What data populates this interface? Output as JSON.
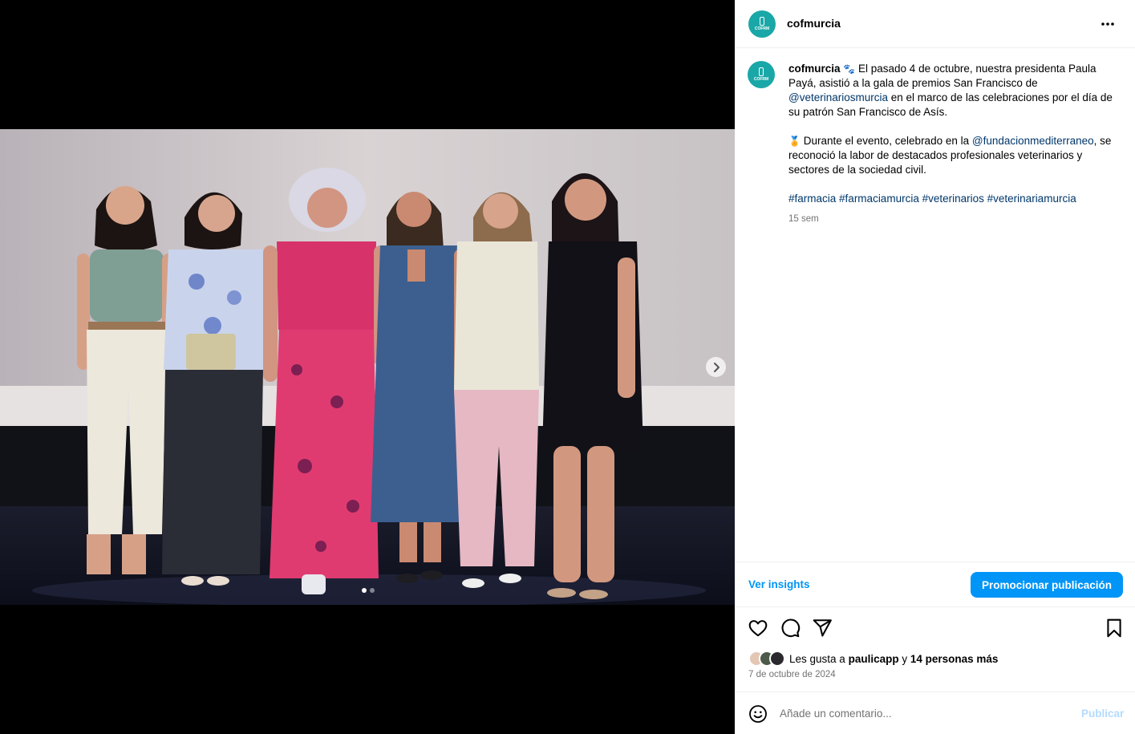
{
  "post": {
    "username": "cofmurcia",
    "avatar_label": "COFRM"
  },
  "caption": {
    "username": "cofmurcia",
    "emoji1": "🐾",
    "text1": "El pasado 4 de octubre, nuestra presidenta Paula Payá, asistió a la gala de premios San Francisco de",
    "mention1": "@veterinariosmurcia",
    "text2": "en el marco de las celebraciones por el día de su patrón San Francisco de Asís.",
    "emoji2": "🏅",
    "text3": "Durante el evento, celebrado en la",
    "mention2": "@fundacionmediterraneo",
    "text4": ", se reconoció la labor de destacados profesionales veterinarios y sectores de la sociedad civil.",
    "hashtags": [
      "#farmacia",
      "#farmaciamurcia",
      "#veterinarios",
      "#veterinariamurcia"
    ],
    "time_ago": "15 sem"
  },
  "insights": {
    "link_label": "Ver insights",
    "promote_label": "Promocionar publicación"
  },
  "icons": {
    "like": "heart-icon",
    "comment": "comment-icon",
    "share": "share-icon",
    "save": "bookmark-icon",
    "more": "more-icon",
    "next": "chevron-right-icon",
    "emoji": "emoji-icon"
  },
  "likes": {
    "prefix": "Les gusta a",
    "user": "paulicapp",
    "connector": "y",
    "others": "14 personas más"
  },
  "date": "7 de octubre de 2024",
  "comment": {
    "placeholder": "Añade un comentario...",
    "publish_label": "Publicar"
  },
  "carousel": {
    "slide_count": 2,
    "active_index": 0
  },
  "colors": {
    "accent": "#0095f6",
    "link": "#00376b",
    "brand": "#1aa7a7",
    "muted": "#737373"
  }
}
